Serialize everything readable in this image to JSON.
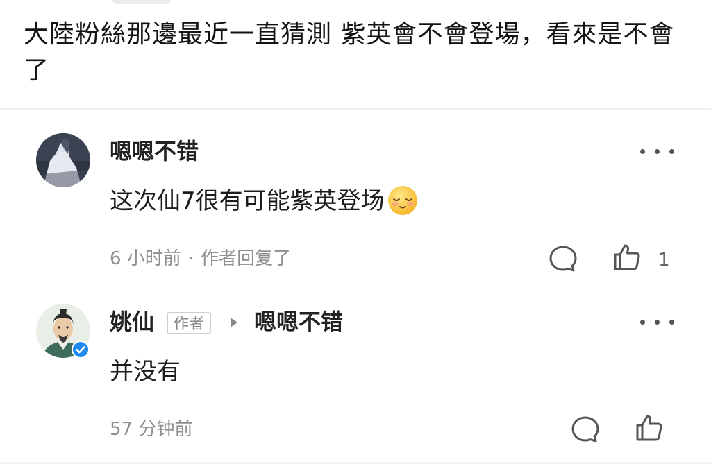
{
  "post": {
    "text": "大陸粉絲那邊最近一直猜測 紫英會不會登場，看來是不會了"
  },
  "comments": [
    {
      "username": "嗯嗯不错",
      "avatar_icon": "avatar-woman-in-white-icon",
      "text": "这次仙7很有可能紫英登场",
      "emoji_icon": "relieved-face-emoji",
      "time": "6 小时前",
      "separator": "·",
      "reply_note": "作者回复了",
      "like_count": "1"
    },
    {
      "username": "姚仙",
      "author_tag": "作者",
      "reply_to": "嗯嗯不错",
      "avatar_icon": "avatar-man-portrait-icon",
      "verified_icon": "verified-check-badge-icon",
      "text": "并没有",
      "time": "57 分钟前"
    }
  ]
}
